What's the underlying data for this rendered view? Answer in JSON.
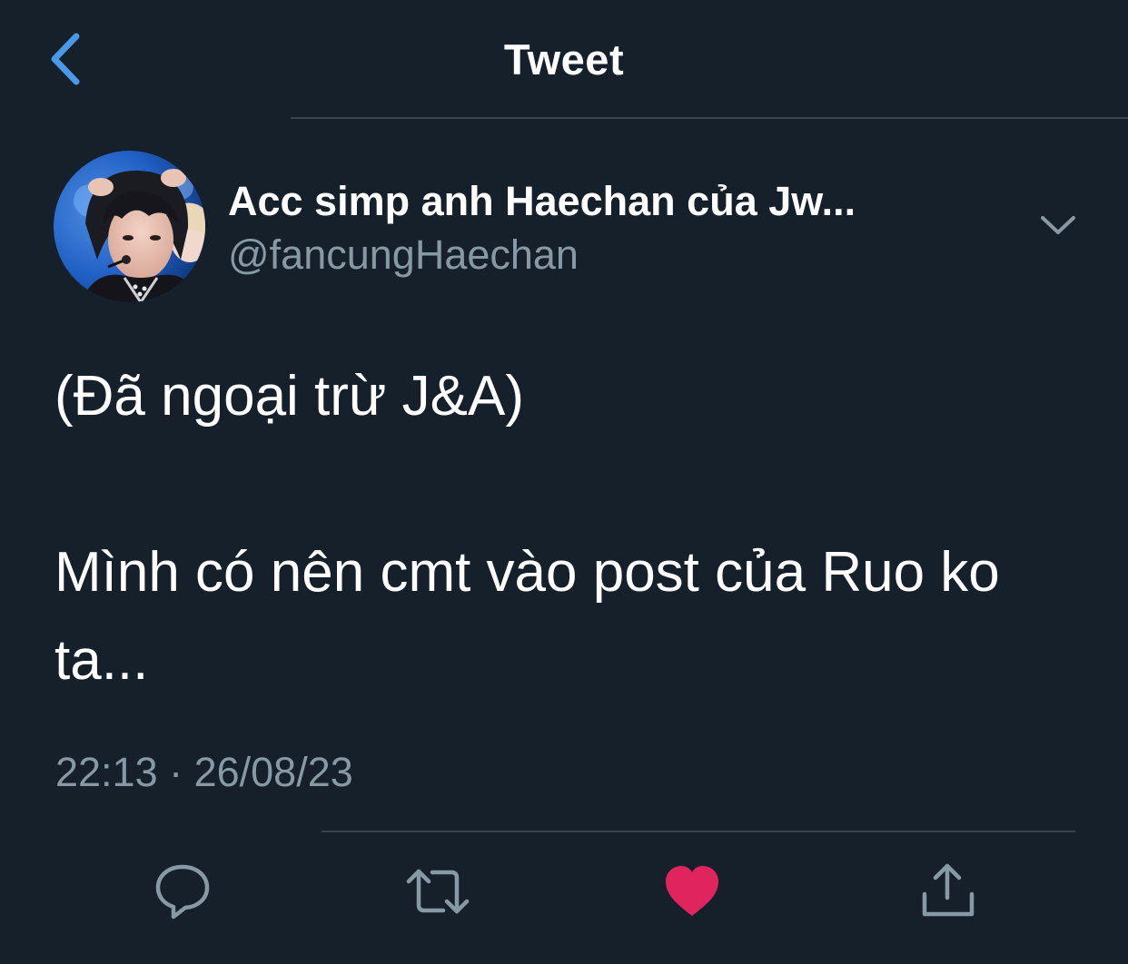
{
  "header": {
    "title": "Tweet",
    "back_icon": "chevron-left-icon"
  },
  "author": {
    "display_name": "Acc simp anh Haechan của Jw...",
    "handle": "@fancungHaechan",
    "more_icon": "chevron-down-icon"
  },
  "tweet": {
    "lines": [
      "(Đã ngoại trừ J&A)",
      "Mình có nên cmt vào post của Ruo ko ta..."
    ],
    "timestamp": "22:13 · 26/08/23"
  },
  "actions": [
    {
      "icon": "reply-icon"
    },
    {
      "icon": "retweet-icon"
    },
    {
      "icon": "like-icon",
      "liked": true
    },
    {
      "icon": "share-icon"
    }
  ],
  "colors": {
    "background": "#15202b",
    "accent": "#1da1f2",
    "like": "#e0245e",
    "muted": "#8899a6",
    "divider": "#38444d"
  }
}
